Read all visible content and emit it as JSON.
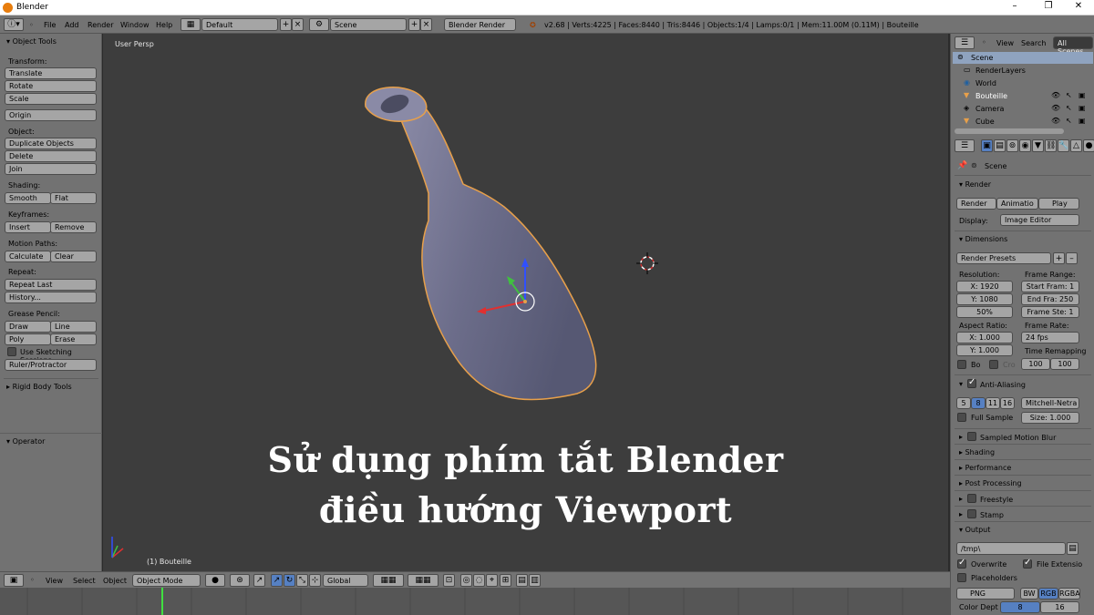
{
  "window": {
    "title": "Blender",
    "minimize": "–",
    "maximize": "❐",
    "close": "✕"
  },
  "header": {
    "menus": [
      "File",
      "Add",
      "Render",
      "Window",
      "Help"
    ],
    "layout": "Default",
    "scene": "Scene",
    "engine": "Blender Render",
    "stats": "v2.68 | Verts:4225 | Faces:8440 | Tris:8446 | Objects:1/4 | Lamps:0/1 | Mem:11.00M (0.11M) | Bouteille"
  },
  "toolshelf": {
    "title": "Object Tools",
    "transform_label": "Transform:",
    "translate": "Translate",
    "rotate": "Rotate",
    "scale": "Scale",
    "origin": "Origin",
    "object_label": "Object:",
    "duplicate": "Duplicate Objects",
    "delete": "Delete",
    "join": "Join",
    "shading_label": "Shading:",
    "smooth": "Smooth",
    "flat": "Flat",
    "keyframes_label": "Keyframes:",
    "insert": "Insert",
    "remove": "Remove",
    "motion_label": "Motion Paths:",
    "calculate": "Calculate",
    "clear": "Clear",
    "repeat_label": "Repeat:",
    "repeat_last": "Repeat Last",
    "history": "History...",
    "grease_label": "Grease Pencil:",
    "draw": "Draw",
    "line": "Line",
    "poly": "Poly",
    "erase": "Erase",
    "sketching": "Use Sketching Sessions",
    "ruler": "Ruler/Protractor",
    "rigid": "Rigid Body Tools",
    "operator": "Operator"
  },
  "viewport": {
    "persp": "User Persp",
    "object": "(1) Bouteille",
    "overlay_line1": "Sử dụng phím tắt Blender",
    "overlay_line2": "điều hướng Viewport"
  },
  "bottombar": {
    "view": "View",
    "select": "Select",
    "object": "Object",
    "mode": "Object Mode",
    "orientation": "Global"
  },
  "outliner": {
    "view": "View",
    "search": "Search",
    "all_scenes": "All Scenes",
    "items": [
      "Scene",
      "RenderLayers",
      "World",
      "Bouteille",
      "Camera",
      "Cube"
    ]
  },
  "properties": {
    "scene": "Scene",
    "render": "Render",
    "render_btn": "Render",
    "animation_btn": "Animatio",
    "play_btn": "Play",
    "display_label": "Display:",
    "display_value": "Image Editor",
    "dimensions": "Dimensions",
    "render_presets": "Render Presets",
    "resolution": "Resolution:",
    "res_x": "X: 1920",
    "res_y": "Y: 1080",
    "res_pct": "50%",
    "frame_range": "Frame Range:",
    "start": "Start Fram: 1",
    "end": "End Fra: 250",
    "step": "Frame Ste: 1",
    "aspect": "Aspect Ratio:",
    "asp_x": "X: 1.000",
    "asp_y": "Y: 1.000",
    "frame_rate": "Frame Rate:",
    "fps": "24 fps",
    "time_remap": "Time Remapping",
    "remap_old": "100",
    "remap_new": "100",
    "bo": "Bo",
    "cro": "Cro",
    "aa": "Anti-Aliasing",
    "aa_samples": [
      "5",
      "8",
      "11",
      "16"
    ],
    "aa_filter": "Mitchell-Netra",
    "full_sample": "Full Sample",
    "size": "Size: 1.000",
    "motion_blur": "Sampled Motion Blur",
    "shading": "Shading",
    "performance": "Performance",
    "post": "Post Processing",
    "freestyle": "Freestyle",
    "stamp": "Stamp",
    "output": "Output",
    "path": "/tmp\\",
    "overwrite": "Overwrite",
    "file_ext": "File Extensio",
    "placeholders": "Placeholders",
    "format": "PNG",
    "bw": "BW",
    "rgb": "RGB",
    "rgba": "RGBA",
    "color_depth": "Color Dept",
    "depth_8": "8",
    "depth_16": "16"
  },
  "colors": {
    "accent": "#5680c2",
    "selection": "#e8a04a",
    "blender_orange": "#e87d0d"
  }
}
